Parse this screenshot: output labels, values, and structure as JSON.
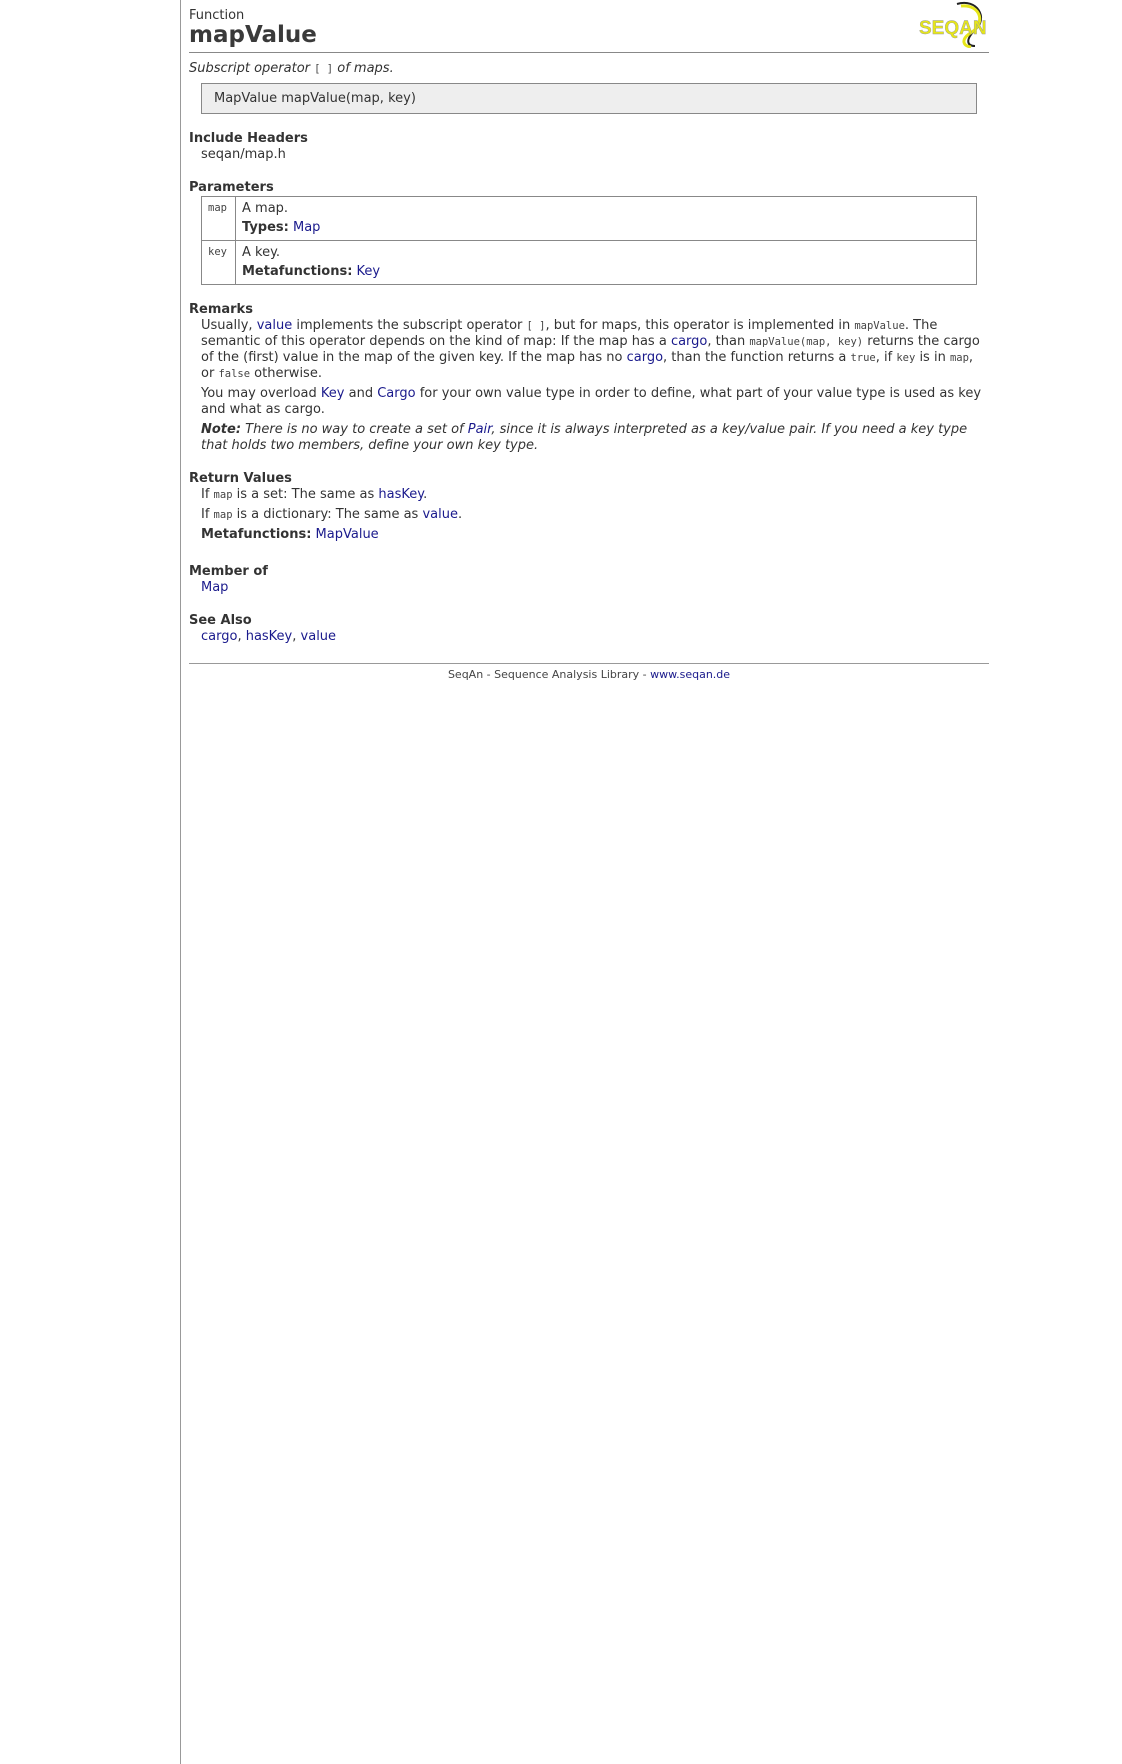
{
  "header": {
    "kind": "Function",
    "title": "mapValue",
    "logo_text": "SEQAN"
  },
  "summary": {
    "pre": "Subscript operator ",
    "code": "[ ]",
    "post": " of maps."
  },
  "signature": "MapValue mapValue(map, key)",
  "include_headers": {
    "heading": "Include Headers",
    "value": "seqan/map.h"
  },
  "parameters": {
    "heading": "Parameters",
    "rows": [
      {
        "name": "map",
        "desc": "A map.",
        "label": "Types:",
        "link": "Map"
      },
      {
        "name": "key",
        "desc": "A key.",
        "label": "Metafunctions:",
        "link": "Key"
      }
    ]
  },
  "remarks": {
    "heading": "Remarks",
    "p1": {
      "t1": "Usually, ",
      "l1": "value",
      "t2": " implements the subscript operator ",
      "c1": "[ ]",
      "t3": ", but for maps, this operator is implemented in ",
      "c2": "mapValue",
      "t4": ". The semantic of this operator depends on the kind of map: If the map has a ",
      "l2": "cargo",
      "t5": ", than ",
      "c3": "mapValue(map, key)",
      "t6": " returns the cargo of the (first) value in the map of the given key. If the map has no ",
      "l3": "cargo",
      "t7": ", than the function returns a ",
      "c4": "true",
      "t8": ", if ",
      "c5": "key",
      "t9": " is in ",
      "c6": "map",
      "t10": ", or ",
      "c7": "false",
      "t11": " otherwise."
    },
    "p2": {
      "t1": "You may overload ",
      "l1": "Key",
      "t2": " and ",
      "l2": "Cargo",
      "t3": " for your own value type in order to define, what part of your value type is used as key and what as cargo."
    },
    "p3": {
      "label": "Note:",
      "t1": " There is no way to create a set of ",
      "l1": "Pair",
      "t2": ", since it is always interpreted as a key/value pair. If you need a key type that holds two members, define your own key type."
    }
  },
  "return_values": {
    "heading": "Return Values",
    "r1": {
      "t1": "If ",
      "c1": "map",
      "t2": " is a set: The same as ",
      "l1": "hasKey",
      "t3": "."
    },
    "r2": {
      "t1": "If ",
      "c1": "map",
      "t2": " is a dictionary: The same as ",
      "l1": "value",
      "t3": "."
    },
    "r3": {
      "label": "Metafunctions:",
      "l1": "MapValue"
    }
  },
  "member_of": {
    "heading": "Member of",
    "link": "Map"
  },
  "see_also": {
    "heading": "See Also",
    "links": [
      "cargo",
      "hasKey",
      "value"
    ],
    "sep": ", "
  },
  "footer": {
    "text": "SeqAn - Sequence Analysis Library - ",
    "link": "www.seqan.de"
  },
  "colors": {
    "link": "#1a1a8c",
    "logo_yellow": "#e6e619",
    "border": "#888888"
  }
}
